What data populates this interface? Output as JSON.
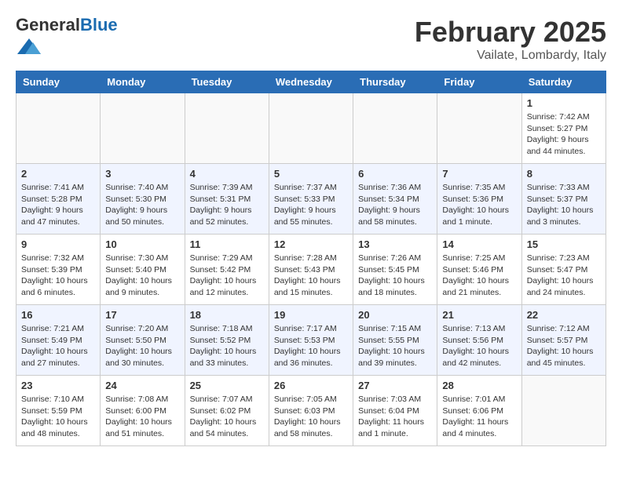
{
  "header": {
    "logo_general": "General",
    "logo_blue": "Blue",
    "month_year": "February 2025",
    "location": "Vailate, Lombardy, Italy"
  },
  "weekdays": [
    "Sunday",
    "Monday",
    "Tuesday",
    "Wednesday",
    "Thursday",
    "Friday",
    "Saturday"
  ],
  "weeks": [
    [
      {
        "day": "",
        "info": ""
      },
      {
        "day": "",
        "info": ""
      },
      {
        "day": "",
        "info": ""
      },
      {
        "day": "",
        "info": ""
      },
      {
        "day": "",
        "info": ""
      },
      {
        "day": "",
        "info": ""
      },
      {
        "day": "1",
        "info": "Sunrise: 7:42 AM\nSunset: 5:27 PM\nDaylight: 9 hours and 44 minutes."
      }
    ],
    [
      {
        "day": "2",
        "info": "Sunrise: 7:41 AM\nSunset: 5:28 PM\nDaylight: 9 hours and 47 minutes."
      },
      {
        "day": "3",
        "info": "Sunrise: 7:40 AM\nSunset: 5:30 PM\nDaylight: 9 hours and 50 minutes."
      },
      {
        "day": "4",
        "info": "Sunrise: 7:39 AM\nSunset: 5:31 PM\nDaylight: 9 hours and 52 minutes."
      },
      {
        "day": "5",
        "info": "Sunrise: 7:37 AM\nSunset: 5:33 PM\nDaylight: 9 hours and 55 minutes."
      },
      {
        "day": "6",
        "info": "Sunrise: 7:36 AM\nSunset: 5:34 PM\nDaylight: 9 hours and 58 minutes."
      },
      {
        "day": "7",
        "info": "Sunrise: 7:35 AM\nSunset: 5:36 PM\nDaylight: 10 hours and 1 minute."
      },
      {
        "day": "8",
        "info": "Sunrise: 7:33 AM\nSunset: 5:37 PM\nDaylight: 10 hours and 3 minutes."
      }
    ],
    [
      {
        "day": "9",
        "info": "Sunrise: 7:32 AM\nSunset: 5:39 PM\nDaylight: 10 hours and 6 minutes."
      },
      {
        "day": "10",
        "info": "Sunrise: 7:30 AM\nSunset: 5:40 PM\nDaylight: 10 hours and 9 minutes."
      },
      {
        "day": "11",
        "info": "Sunrise: 7:29 AM\nSunset: 5:42 PM\nDaylight: 10 hours and 12 minutes."
      },
      {
        "day": "12",
        "info": "Sunrise: 7:28 AM\nSunset: 5:43 PM\nDaylight: 10 hours and 15 minutes."
      },
      {
        "day": "13",
        "info": "Sunrise: 7:26 AM\nSunset: 5:45 PM\nDaylight: 10 hours and 18 minutes."
      },
      {
        "day": "14",
        "info": "Sunrise: 7:25 AM\nSunset: 5:46 PM\nDaylight: 10 hours and 21 minutes."
      },
      {
        "day": "15",
        "info": "Sunrise: 7:23 AM\nSunset: 5:47 PM\nDaylight: 10 hours and 24 minutes."
      }
    ],
    [
      {
        "day": "16",
        "info": "Sunrise: 7:21 AM\nSunset: 5:49 PM\nDaylight: 10 hours and 27 minutes."
      },
      {
        "day": "17",
        "info": "Sunrise: 7:20 AM\nSunset: 5:50 PM\nDaylight: 10 hours and 30 minutes."
      },
      {
        "day": "18",
        "info": "Sunrise: 7:18 AM\nSunset: 5:52 PM\nDaylight: 10 hours and 33 minutes."
      },
      {
        "day": "19",
        "info": "Sunrise: 7:17 AM\nSunset: 5:53 PM\nDaylight: 10 hours and 36 minutes."
      },
      {
        "day": "20",
        "info": "Sunrise: 7:15 AM\nSunset: 5:55 PM\nDaylight: 10 hours and 39 minutes."
      },
      {
        "day": "21",
        "info": "Sunrise: 7:13 AM\nSunset: 5:56 PM\nDaylight: 10 hours and 42 minutes."
      },
      {
        "day": "22",
        "info": "Sunrise: 7:12 AM\nSunset: 5:57 PM\nDaylight: 10 hours and 45 minutes."
      }
    ],
    [
      {
        "day": "23",
        "info": "Sunrise: 7:10 AM\nSunset: 5:59 PM\nDaylight: 10 hours and 48 minutes."
      },
      {
        "day": "24",
        "info": "Sunrise: 7:08 AM\nSunset: 6:00 PM\nDaylight: 10 hours and 51 minutes."
      },
      {
        "day": "25",
        "info": "Sunrise: 7:07 AM\nSunset: 6:02 PM\nDaylight: 10 hours and 54 minutes."
      },
      {
        "day": "26",
        "info": "Sunrise: 7:05 AM\nSunset: 6:03 PM\nDaylight: 10 hours and 58 minutes."
      },
      {
        "day": "27",
        "info": "Sunrise: 7:03 AM\nSunset: 6:04 PM\nDaylight: 11 hours and 1 minute."
      },
      {
        "day": "28",
        "info": "Sunrise: 7:01 AM\nSunset: 6:06 PM\nDaylight: 11 hours and 4 minutes."
      },
      {
        "day": "",
        "info": ""
      }
    ]
  ]
}
